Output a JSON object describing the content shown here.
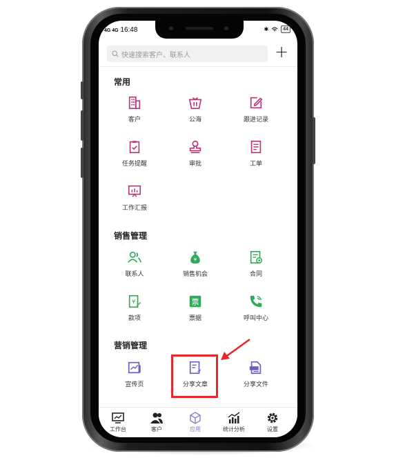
{
  "status_bar": {
    "signal": "4G 4G",
    "time": "16:48",
    "battery": "44"
  },
  "search": {
    "placeholder": "快速搜索客户、联系人"
  },
  "sections": [
    {
      "title": "常用",
      "items": [
        {
          "label": "客户",
          "icon": "building-icon"
        },
        {
          "label": "公海",
          "icon": "sea-basket-icon"
        },
        {
          "label": "跟进记录",
          "icon": "edit-record-icon"
        },
        {
          "label": "任务提醒",
          "icon": "task-clipboard-icon"
        },
        {
          "label": "审批",
          "icon": "stamp-icon"
        },
        {
          "label": "工单",
          "icon": "work-order-icon"
        },
        {
          "label": "工作汇报",
          "icon": "report-board-icon"
        }
      ]
    },
    {
      "title": "销售管理",
      "items": [
        {
          "label": "联系人",
          "icon": "contacts-icon"
        },
        {
          "label": "销售机会",
          "icon": "money-bag-icon"
        },
        {
          "label": "合同",
          "icon": "contract-icon"
        },
        {
          "label": "款项",
          "icon": "payment-icon"
        },
        {
          "label": "票据",
          "icon": "invoice-icon"
        },
        {
          "label": "呼叫中心",
          "icon": "phone-call-icon"
        }
      ]
    },
    {
      "title": "营销管理",
      "items": [
        {
          "label": "宣传页",
          "icon": "flyer-icon"
        },
        {
          "label": "分享文章",
          "icon": "share-article-icon"
        },
        {
          "label": "分享文件",
          "icon": "share-file-icon"
        }
      ]
    }
  ],
  "tabs": [
    {
      "label": "工作台",
      "icon": "workbench-icon"
    },
    {
      "label": "客户",
      "icon": "customers-icon"
    },
    {
      "label": "应用",
      "icon": "apps-cube-icon",
      "active": true
    },
    {
      "label": "统计分析",
      "icon": "stats-chart-icon"
    },
    {
      "label": "设置",
      "icon": "settings-gear-icon"
    }
  ],
  "colors": {
    "common": "#b8357a",
    "sales": "#2faa5a",
    "marketing": "#6a5fc1",
    "highlight": "#e8262b",
    "active_tab": "#8a7cc9"
  }
}
